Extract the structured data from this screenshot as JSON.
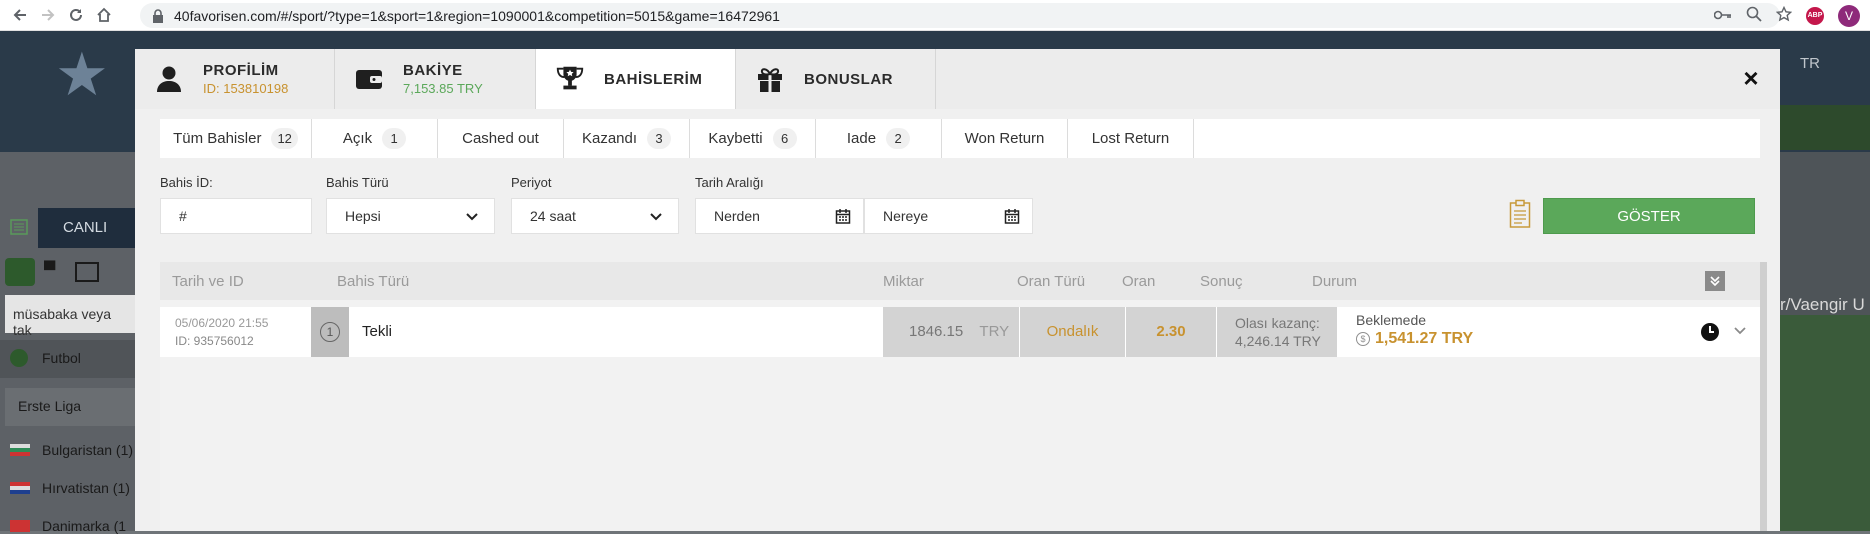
{
  "browser": {
    "url": "40favorisen.com/#/sport/?type=1&sport=1&region=1090001&competition=5015&game=16472961",
    "abp_label": "ABP",
    "profile_initial": "V"
  },
  "site": {
    "lang": "TR",
    "canli": "CANLI",
    "search_placeholder": "müsabaka veya tak",
    "sport": "Futbol",
    "league": "Erste Liga",
    "countries": [
      "Bulgaristan (1)",
      "Hırvatistan (1)",
      "Danimarka (1"
    ],
    "right_text": "r/Vaengir U"
  },
  "modal": {
    "tabs": [
      {
        "title": "PROFİLİM",
        "sub": "ID: 153810198",
        "icon": "user-icon"
      },
      {
        "title": "BAKİYE",
        "sub": "7,153.85 TRY",
        "icon": "wallet-icon"
      },
      {
        "title": "BAHİSLERİM",
        "sub": "",
        "icon": "trophy-icon"
      },
      {
        "title": "BONUSLAR",
        "sub": "",
        "icon": "gift-icon"
      }
    ],
    "close": "×",
    "filter_tabs": [
      {
        "label": "Tüm Bahisler",
        "count": "12"
      },
      {
        "label": "Açık",
        "count": "1"
      },
      {
        "label": "Cashed out",
        "count": ""
      },
      {
        "label": "Kazandı",
        "count": "3"
      },
      {
        "label": "Kaybetti",
        "count": "6"
      },
      {
        "label": "Iade",
        "count": "2"
      },
      {
        "label": "Won Return",
        "count": ""
      },
      {
        "label": "Lost Return",
        "count": ""
      }
    ],
    "filters": {
      "bet_id_label": "Bahis İD:",
      "bet_id_value": "#",
      "bet_type_label": "Bahis Türü",
      "bet_type_value": "Hepsi",
      "period_label": "Periyot",
      "period_value": "24 saat",
      "date_range_label": "Tarih Aralığı",
      "from_value": "Nerden",
      "to_value": "Nereye",
      "show_button": "GÖSTER"
    },
    "table": {
      "headers": [
        "Tarih ve ID",
        "Bahis Türü",
        "Miktar",
        "Oran Türü",
        "Oran",
        "Sonuç",
        "Durum"
      ],
      "rows": [
        {
          "date": "05/06/2020 21:55",
          "id": "ID: 935756012",
          "num": "1",
          "type": "Tekli",
          "amount": "1846.15",
          "currency": "TRY",
          "odds_type": "Ondalık",
          "odds": "2.30",
          "result_label": "Olası kazanç:",
          "result_value": "4,246.14 TRY",
          "status": "Beklemede",
          "status_amount": "1,541.27 TRY",
          "coin": "$"
        }
      ]
    }
  }
}
